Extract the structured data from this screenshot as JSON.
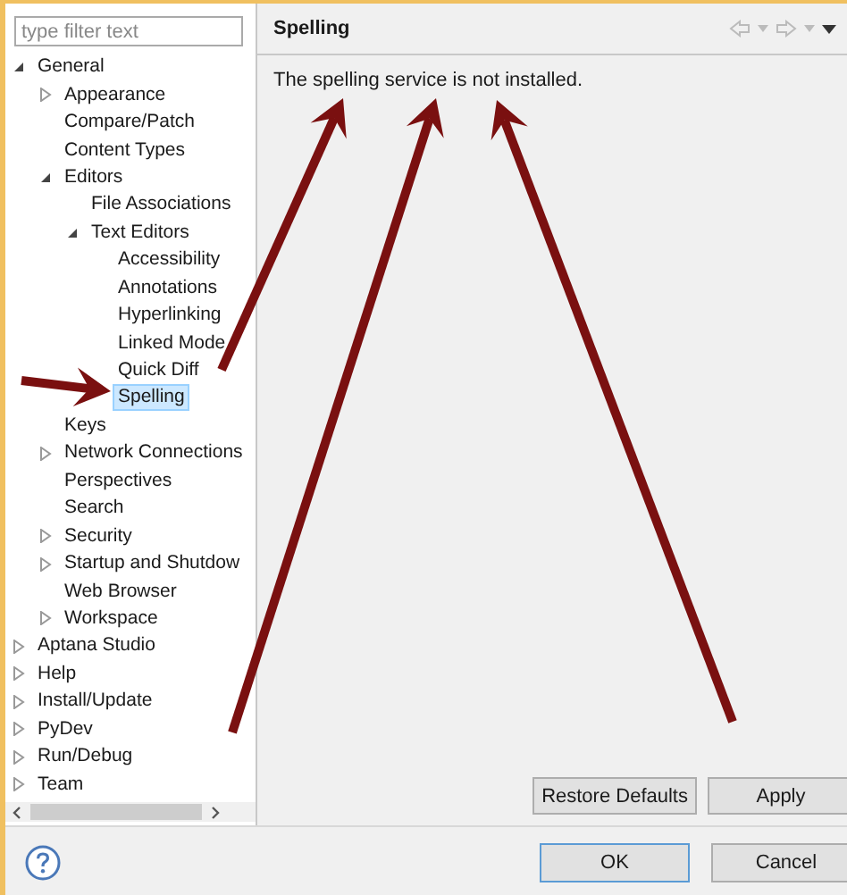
{
  "filter": {
    "placeholder": "type filter text"
  },
  "tree": [
    {
      "label": "General",
      "expanded": true,
      "selected": false,
      "children": [
        {
          "label": "Appearance",
          "expanded": false,
          "selected": false
        },
        {
          "label": "Compare/Patch",
          "selected": false
        },
        {
          "label": "Content Types",
          "selected": false
        },
        {
          "label": "Editors",
          "expanded": true,
          "selected": false,
          "children": [
            {
              "label": "File Associations",
              "selected": false
            },
            {
              "label": "Text Editors",
              "expanded": true,
              "selected": false,
              "children": [
                {
                  "label": "Accessibility",
                  "selected": false
                },
                {
                  "label": "Annotations",
                  "selected": false
                },
                {
                  "label": "Hyperlinking",
                  "selected": false
                },
                {
                  "label": "Linked Mode",
                  "selected": false
                },
                {
                  "label": "Quick Diff",
                  "selected": false
                },
                {
                  "label": "Spelling",
                  "selected": true
                }
              ]
            }
          ]
        },
        {
          "label": "Keys",
          "selected": false
        },
        {
          "label": "Network Connections",
          "expanded": false,
          "selected": false
        },
        {
          "label": "Perspectives",
          "selected": false
        },
        {
          "label": "Search",
          "selected": false
        },
        {
          "label": "Security",
          "expanded": false,
          "selected": false
        },
        {
          "label": "Startup and Shutdow",
          "expanded": false,
          "selected": false
        },
        {
          "label": "Web Browser",
          "selected": false
        },
        {
          "label": "Workspace",
          "expanded": false,
          "selected": false
        }
      ]
    },
    {
      "label": "Aptana Studio",
      "expanded": false,
      "selected": false
    },
    {
      "label": "Help",
      "expanded": false,
      "selected": false
    },
    {
      "label": "Install/Update",
      "expanded": false,
      "selected": false
    },
    {
      "label": "PyDev",
      "expanded": false,
      "selected": false
    },
    {
      "label": "Run/Debug",
      "expanded": false,
      "selected": false
    },
    {
      "label": "Team",
      "expanded": false,
      "selected": false
    }
  ],
  "page": {
    "title": "Spelling",
    "message": "The spelling service is not installed."
  },
  "page_buttons": [
    "Restore Defaults",
    "Apply"
  ],
  "dialog_buttons": [
    {
      "label": "OK",
      "default": true
    },
    {
      "label": "Cancel",
      "default": false
    }
  ]
}
